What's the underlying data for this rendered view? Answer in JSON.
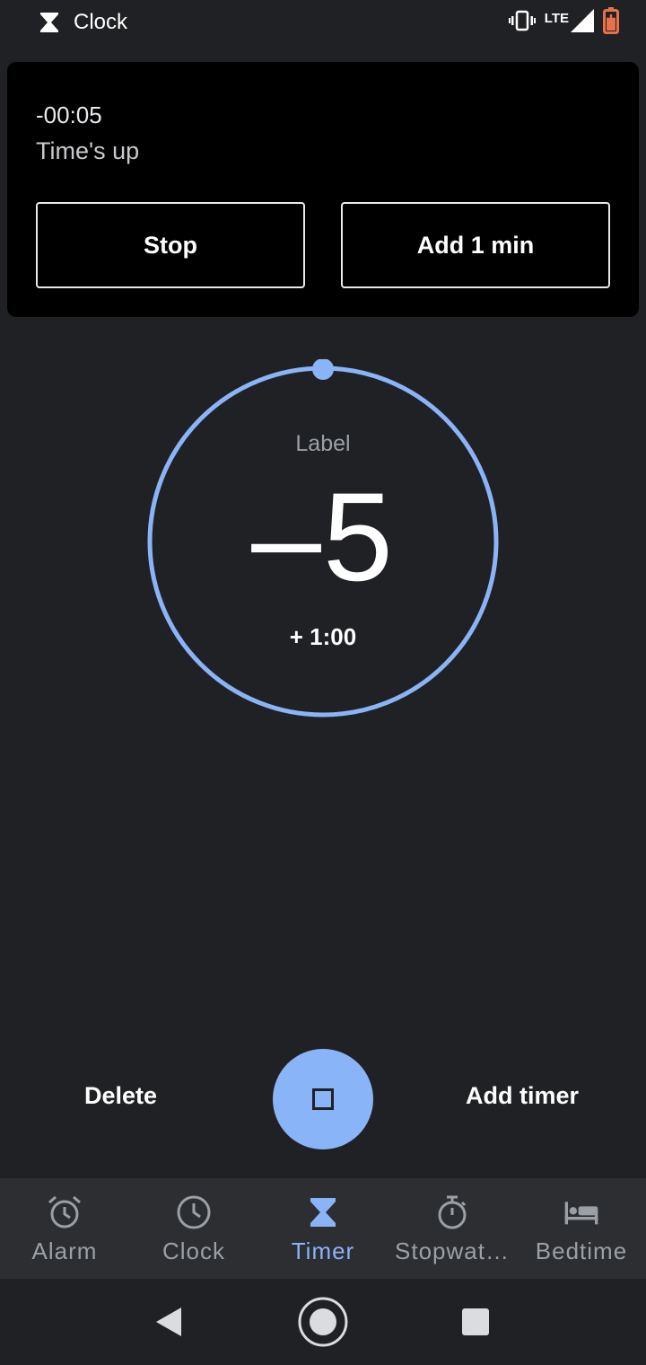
{
  "status_bar": {
    "app_name": "Clock",
    "network": "LTE"
  },
  "notification": {
    "time": "-00:05",
    "message": "Time's up",
    "stop_label": "Stop",
    "add_label": "Add 1 min"
  },
  "timer": {
    "label": "Label",
    "value": "–5",
    "add_text": "+ 1:00"
  },
  "actions": {
    "delete_label": "Delete",
    "add_timer_label": "Add timer"
  },
  "bottom_nav": {
    "items": [
      {
        "label": "Alarm",
        "icon": "alarm-icon",
        "active": false
      },
      {
        "label": "Clock",
        "icon": "clock-icon",
        "active": false
      },
      {
        "label": "Timer",
        "icon": "hourglass-icon",
        "active": true
      },
      {
        "label": "Stopwat…",
        "icon": "stopwatch-icon",
        "active": false
      },
      {
        "label": "Bedtime",
        "icon": "bed-icon",
        "active": false
      }
    ]
  },
  "colors": {
    "accent": "#8ab4f8",
    "background": "#202124",
    "nav_background": "#2d2e31",
    "battery": "#e8714a"
  }
}
